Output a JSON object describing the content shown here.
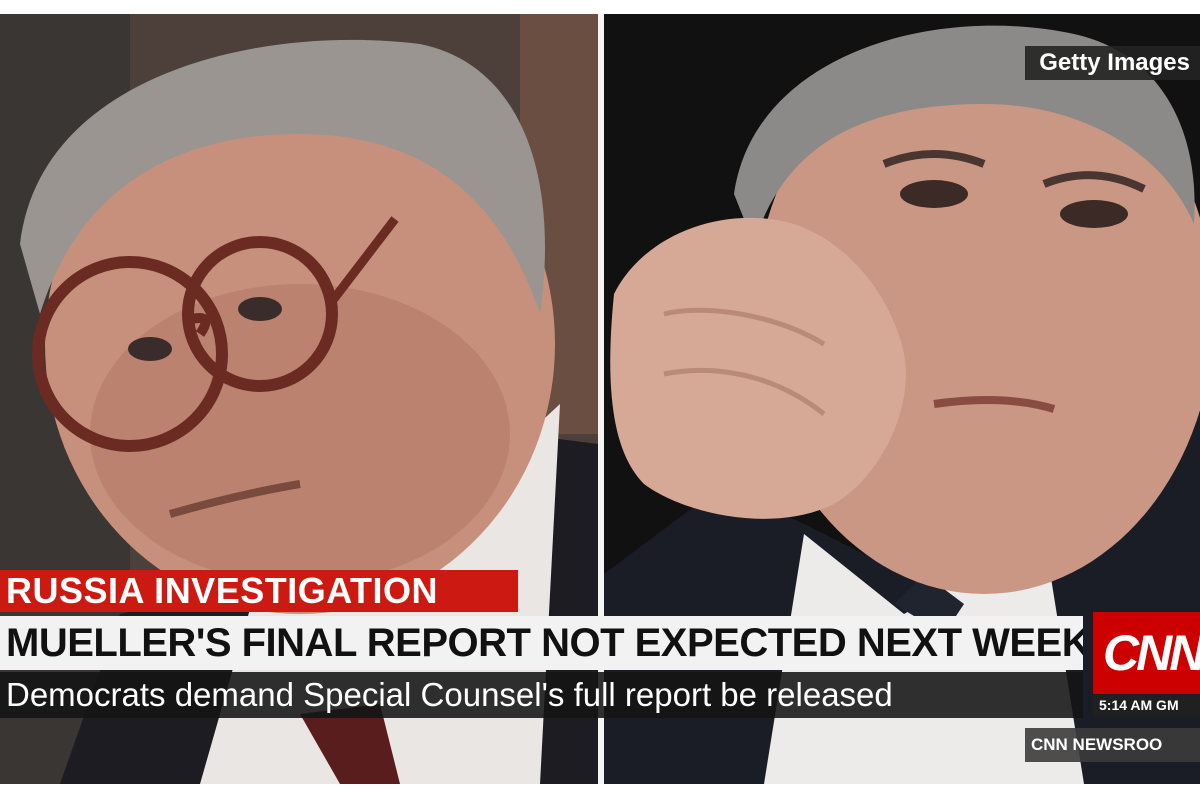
{
  "photo_credit": "Getty Images",
  "chyron": {
    "topic": "RUSSIA INVESTIGATION",
    "headline": "MUELLER'S FINAL REPORT NOT EXPECTED NEXT WEEK",
    "subheadline": "Democrats demand Special Counsel's full report be released"
  },
  "network": {
    "logo_text": "CNN",
    "time": "5:14 AM GM",
    "program": "CNN NEWSROO"
  },
  "colors": {
    "topic_bar": "#cc1a12",
    "logo": "#cc0000",
    "headline_bar": "#f2f2f2"
  }
}
